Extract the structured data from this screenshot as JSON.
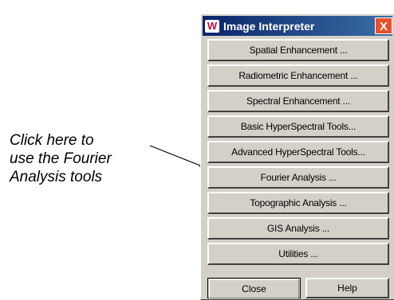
{
  "annotation": {
    "lines": [
      "Click here to",
      "use the Fourier",
      "Analysis tools"
    ]
  },
  "window": {
    "title": "Image Interpreter",
    "app_icon_glyph": "W",
    "close_glyph": "X",
    "buttons": [
      "Spatial Enhancement ...",
      "Radiometric Enhancement ...",
      "Spectral Enhancement ...",
      "Basic HyperSpectral Tools...",
      "Advanced HyperSpectral Tools...",
      "Fourier Analysis ...",
      "Topographic Analysis ...",
      "GIS Analysis ...",
      "Utilities ..."
    ],
    "close_label": "Close",
    "help_label": "Help"
  },
  "colors": {
    "titlebar_start": "#0a246a",
    "titlebar_end": "#3a6ea5",
    "close_x": "#e8502c",
    "face": "#d4d0c8"
  }
}
